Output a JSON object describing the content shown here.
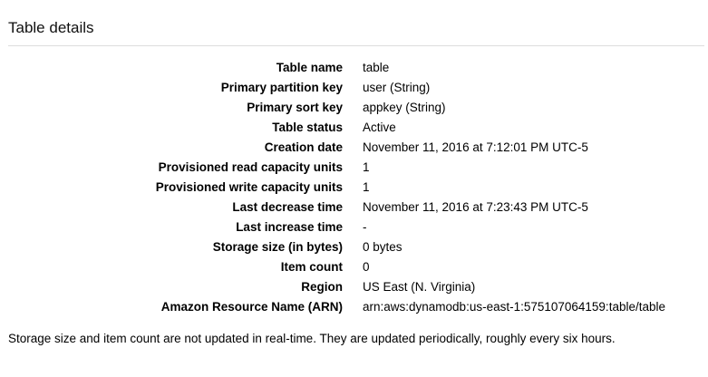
{
  "panel": {
    "title": "Table details"
  },
  "details": [
    {
      "label": "Table name",
      "value": "table"
    },
    {
      "label": "Primary partition key",
      "value": "user (String)"
    },
    {
      "label": "Primary sort key",
      "value": "appkey (String)"
    },
    {
      "label": "Table status",
      "value": "Active"
    },
    {
      "label": "Creation date",
      "value": "November 11, 2016 at 7:12:01 PM UTC-5"
    },
    {
      "label": "Provisioned read capacity units",
      "value": "1"
    },
    {
      "label": "Provisioned write capacity units",
      "value": "1"
    },
    {
      "label": "Last decrease time",
      "value": "November 11, 2016 at 7:23:43 PM UTC-5"
    },
    {
      "label": "Last increase time",
      "value": "-"
    },
    {
      "label": "Storage size (in bytes)",
      "value": "0 bytes"
    },
    {
      "label": "Item count",
      "value": "0"
    },
    {
      "label": "Region",
      "value": "US East (N. Virginia)"
    },
    {
      "label": "Amazon Resource Name (ARN)",
      "value": "arn:aws:dynamodb:us-east-1:575107064159:table/table"
    }
  ],
  "footer_note": "Storage size and item count are not updated in real-time. They are updated periodically, roughly every six hours."
}
